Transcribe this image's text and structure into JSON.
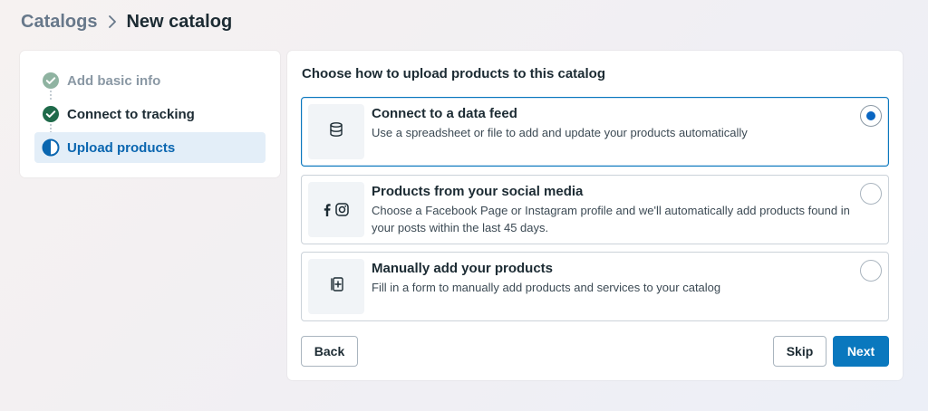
{
  "breadcrumb": {
    "parent": "Catalogs",
    "current": "New catalog"
  },
  "steps": [
    {
      "label": "Add basic info",
      "state": "done-faded",
      "icon": "check-circle-icon"
    },
    {
      "label": "Connect to tracking",
      "state": "done",
      "icon": "check-circle-icon"
    },
    {
      "label": "Upload products",
      "state": "active",
      "icon": "half-circle-icon"
    }
  ],
  "main": {
    "title": "Choose how to upload products to this catalog",
    "options": [
      {
        "title": "Connect to a data feed",
        "description": "Use a spreadsheet or file to add and update your products automatically",
        "icon": "database-icon",
        "selected": true
      },
      {
        "title": "Products from your social media",
        "description": "Choose a Facebook Page or Instagram profile and we'll automatically add products found in your posts within the last 45 days.",
        "icon": "facebook-instagram-icon",
        "selected": false
      },
      {
        "title": "Manually add your products",
        "description": "Fill in a form to manually add products and services to your catalog",
        "icon": "add-card-icon",
        "selected": false
      }
    ]
  },
  "buttons": {
    "back": "Back",
    "skip": "Skip",
    "next": "Next"
  },
  "colors": {
    "accent": "#0a78be",
    "active_step_bg": "#e3eef8",
    "done_green": "#1f6a4a",
    "faded_green": "#8fb3a1"
  }
}
